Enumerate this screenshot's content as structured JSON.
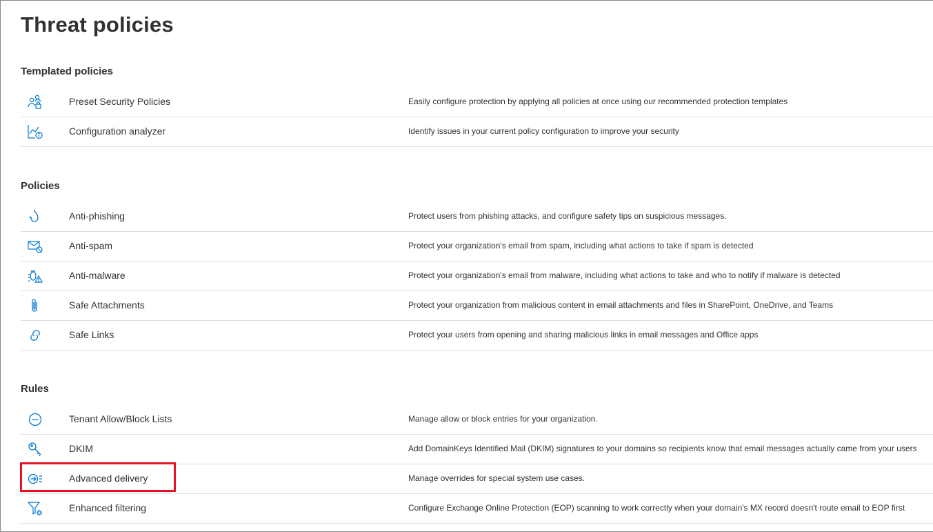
{
  "page": {
    "title": "Threat policies"
  },
  "sections": {
    "templated": {
      "title": "Templated policies",
      "items": [
        {
          "name": "Preset Security Policies",
          "description": "Easily configure protection by applying all policies at once using our recommended protection templates",
          "icon": "people-lock-icon"
        },
        {
          "name": "Configuration analyzer",
          "description": "Identify issues in your current policy configuration to improve your security",
          "icon": "chart-info-icon"
        }
      ]
    },
    "policies": {
      "title": "Policies",
      "items": [
        {
          "name": "Anti-phishing",
          "description": "Protect users from phishing attacks, and configure safety tips on suspicious messages.",
          "icon": "fish-hook-icon"
        },
        {
          "name": "Anti-spam",
          "description": "Protect your organization's email from spam, including what actions to take if spam is detected",
          "icon": "mail-blocked-icon"
        },
        {
          "name": "Anti-malware",
          "description": "Protect your organization's email from malware, including what actions to take and who to notify if malware is detected",
          "icon": "bug-warning-icon"
        },
        {
          "name": "Safe Attachments",
          "description": "Protect your organization from malicious content in email attachments and files in SharePoint, OneDrive, and Teams",
          "icon": "paperclip-icon"
        },
        {
          "name": "Safe Links",
          "description": "Protect your users from opening and sharing malicious links in email messages and Office apps",
          "icon": "link-icon"
        }
      ]
    },
    "rules": {
      "title": "Rules",
      "items": [
        {
          "name": "Tenant Allow/Block Lists",
          "description": "Manage allow or block entries for your organization.",
          "icon": "block-circle-icon"
        },
        {
          "name": "DKIM",
          "description": "Add DomainKeys Identified Mail (DKIM) signatures to your domains so recipients know that email messages actually came from your users",
          "icon": "key-icon"
        },
        {
          "name": "Advanced delivery",
          "description": "Manage overrides for special system use cases.",
          "icon": "arrow-list-icon"
        },
        {
          "name": "Enhanced filtering",
          "description": "Configure Exchange Online Protection (EOP) scanning to work correctly when your domain's MX record doesn't route email to EOP first",
          "icon": "filter-gear-icon"
        }
      ]
    }
  },
  "colors": {
    "icon": "#0078d4",
    "text": "#323130",
    "divider": "#e1dfdd",
    "highlight": "#e81123"
  }
}
